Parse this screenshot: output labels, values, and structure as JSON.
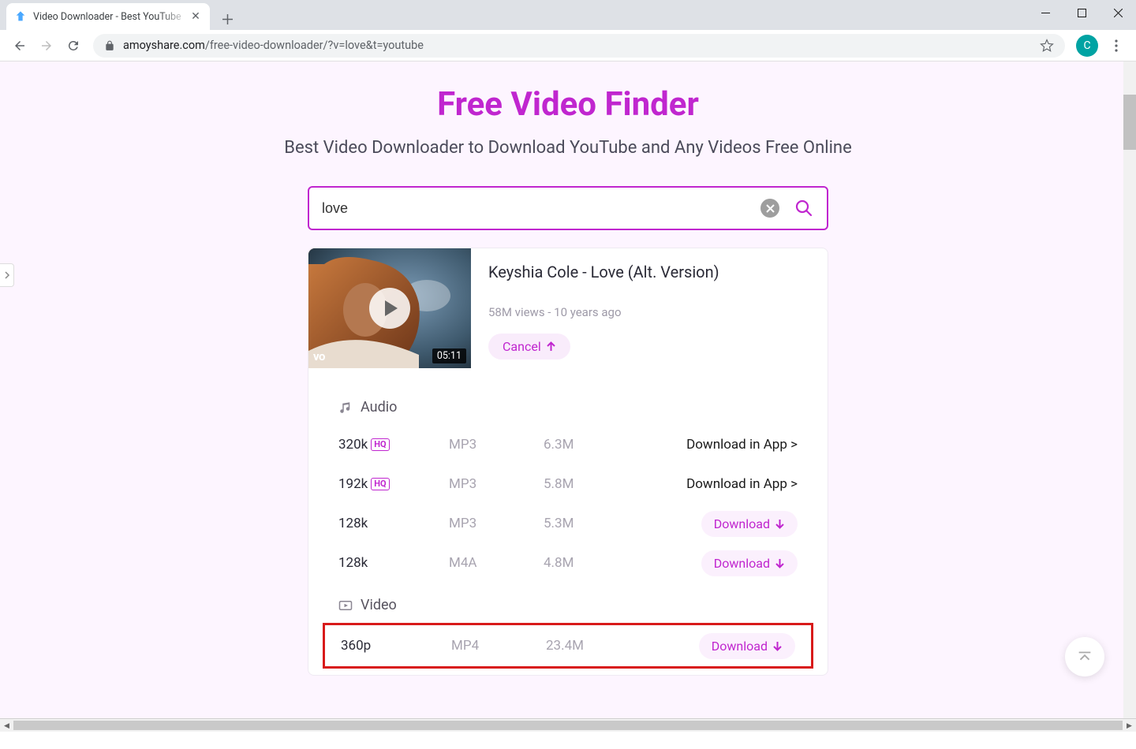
{
  "window": {
    "tab_title": "Video Downloader - Best YouTube",
    "url_prefix": "amoyshare.com",
    "url_path": "/free-video-downloader/?v=love&t=youtube",
    "profile_initial": "C"
  },
  "hero": {
    "title": "Free Video Finder",
    "subtitle": "Best Video Downloader to Download YouTube and Any Videos Free Online"
  },
  "search": {
    "value": "love"
  },
  "result": {
    "title": "Keyshia Cole - Love (Alt. Version)",
    "stats": "58M views - 10 years ago",
    "duration": "05:11",
    "vevo": "vo",
    "cancel_label": "Cancel"
  },
  "sections": {
    "audio_label": "Audio",
    "video_label": "Video",
    "download_label": "Download",
    "app_label": "Download in App >",
    "hq_label": "HQ"
  },
  "audio": [
    {
      "quality": "320k",
      "hq": true,
      "type": "MP3",
      "size": "6.3M",
      "action": "app"
    },
    {
      "quality": "192k",
      "hq": true,
      "type": "MP3",
      "size": "5.8M",
      "action": "app"
    },
    {
      "quality": "128k",
      "hq": false,
      "type": "MP3",
      "size": "5.3M",
      "action": "download"
    },
    {
      "quality": "128k",
      "hq": false,
      "type": "M4A",
      "size": "4.8M",
      "action": "download"
    }
  ],
  "video": [
    {
      "quality": "360p",
      "type": "MP4",
      "size": "23.4M",
      "action": "download",
      "highlight": true
    }
  ]
}
